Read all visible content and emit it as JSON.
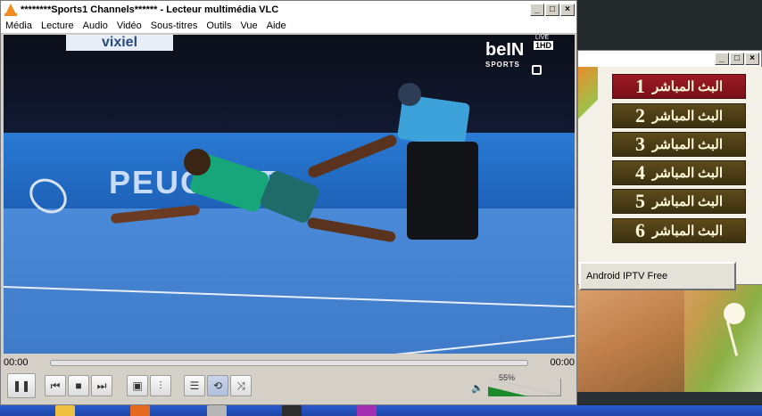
{
  "vlc": {
    "title": "********Sports1 Channels****** - Lecteur multimédia VLC",
    "menu": [
      "Média",
      "Lecture",
      "Audio",
      "Vidéo",
      "Sous-titres",
      "Outils",
      "Vue",
      "Aide"
    ],
    "video": {
      "channel_logo": "beIN",
      "channel_logo_sub": "SPORTS",
      "channel_badge": "1HD",
      "live_label": "LIVE",
      "banner_text": "PEUGEOT",
      "top_banner_text": "vixiel"
    },
    "time_elapsed": "00:00",
    "time_total": "00:00",
    "volume_text": "55%",
    "volume_level": 0.55,
    "controls": {
      "play_pause_icon": "pause-icon",
      "prev_icon": "previous-icon",
      "stop_icon": "stop-icon",
      "next_icon": "next-icon",
      "fullscreen_icon": "fullscreen-icon",
      "extended_icon": "equalizer-icon",
      "playlist_icon": "playlist-icon",
      "loop_icon": "loop-icon",
      "shuffle_icon": "shuffle-icon"
    }
  },
  "iptv": {
    "channels": [
      {
        "label": "البث المباشر",
        "number": "1",
        "selected": true
      },
      {
        "label": "البث المباشر",
        "number": "2",
        "selected": false
      },
      {
        "label": "البث المباشر",
        "number": "3",
        "selected": false
      },
      {
        "label": "البث المباشر",
        "number": "4",
        "selected": false
      },
      {
        "label": "البث المباشر",
        "number": "5",
        "selected": false
      },
      {
        "label": "البث المباشر",
        "number": "6",
        "selected": false
      }
    ],
    "android_button": "Android IPTV Free"
  },
  "window_buttons": {
    "minimize": "_",
    "maximize": "□",
    "close": "×"
  },
  "colors": {
    "selected_channel": "#8a1520",
    "channel": "#4d3f15",
    "volume_fill": "#1d8a2b",
    "taskbar": "#2452c2"
  }
}
